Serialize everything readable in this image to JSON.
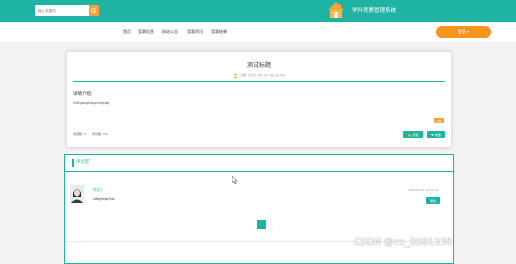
{
  "header": {
    "search_placeholder": "输入关键词",
    "site_title": "学科竞赛管理系统"
  },
  "nav": {
    "items": [
      "首页",
      "竞赛信息",
      "网站公告",
      "竞赛资讯",
      "竞赛结果"
    ],
    "login_label": "登录 ▾"
  },
  "article": {
    "title": "测试标题",
    "author": "小明",
    "date": "2023-05-30 16:31:49",
    "intro_label": "详情介绍:",
    "intro_text": "fdsfgasgfsdgfsdgsdg",
    "tag": "竞赛",
    "stats": [
      {
        "label": "浏览数:",
        "value": "2"
      },
      {
        "label": "评论数:",
        "value": "1/1"
      }
    ],
    "actions": {
      "like": "点赞",
      "collect": "收藏"
    }
  },
  "comments": {
    "header": "评论区",
    "items": [
      {
        "user": "学生1",
        "text": "sdfgfsdg fds",
        "time": "2023-05-30 16:32:40",
        "delete_label": "删除"
      }
    ],
    "pager": {
      "prev": "‹",
      "current": "1",
      "next": "›"
    }
  },
  "watermark": "CSDN @vx_BS81330",
  "colors": {
    "accent": "#1fb3a3",
    "orange": "#f7941d"
  }
}
